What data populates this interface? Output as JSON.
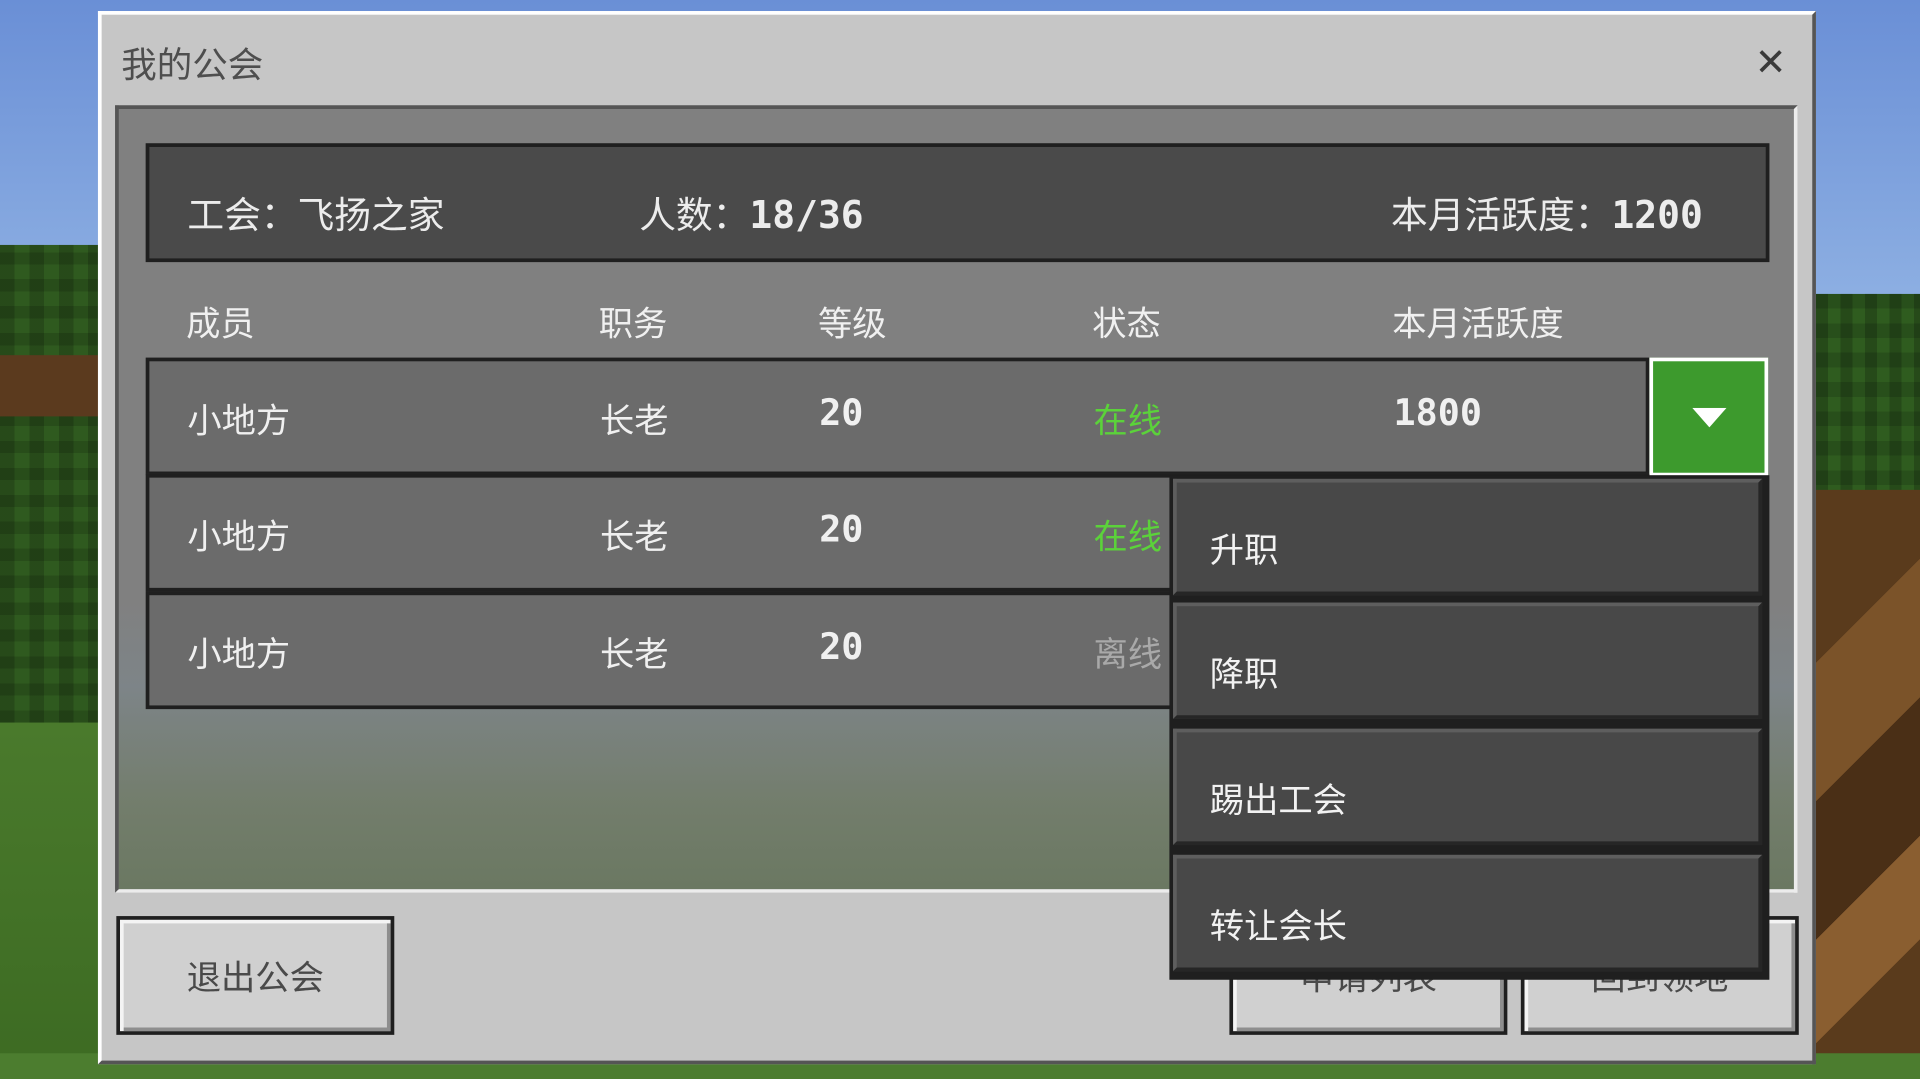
{
  "dialog": {
    "title": "我的公会"
  },
  "guild_info": {
    "name_label": "工会：飞扬之家",
    "members_label": "人数：",
    "members_value": "18/36",
    "activity_label": "本月活跃度：",
    "activity_value": "1200"
  },
  "table": {
    "headers": [
      "成员",
      "职务",
      "等级",
      "状态",
      "本月活跃度"
    ],
    "rows": [
      {
        "member": "小地方",
        "role": "长老",
        "level": "20",
        "status": "在线",
        "activity": "1800"
      },
      {
        "member": "小地方",
        "role": "长老",
        "level": "20",
        "status": "在线"
      },
      {
        "member": "小地方",
        "role": "长老",
        "level": "20",
        "status": "离线"
      }
    ]
  },
  "menu": {
    "items": [
      "升职",
      "降职",
      "踢出工会",
      "转让会长"
    ]
  },
  "buttons": {
    "leave": "退出公会",
    "applications": "申请列表",
    "return": "回到领地"
  },
  "colors": {
    "online": "#5bd23a",
    "offline": "#a9a9a9",
    "accent": "#3d9a2d"
  },
  "icons": {
    "close": "close-icon",
    "dropdown": "triangle-down-icon"
  }
}
